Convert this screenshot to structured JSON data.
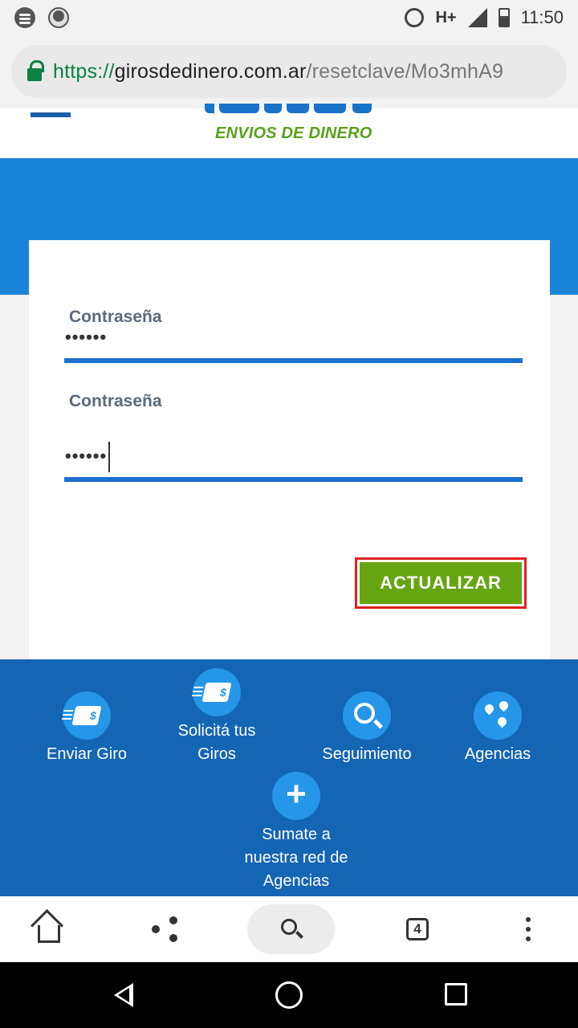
{
  "status_bar": {
    "network": "H+",
    "time": "11:50"
  },
  "url_bar": {
    "scheme": "https://",
    "host": "girosdedinero.com.ar",
    "path": "/resetclave/Mo3mhA9"
  },
  "header": {
    "logo_text": "ENVIOS DE DINERO"
  },
  "form": {
    "fields": [
      {
        "label": "Contraseña",
        "value": "••••••"
      },
      {
        "label": "Contraseña",
        "value": "••••••"
      }
    ],
    "submit_label": "ACTUALIZAR"
  },
  "footer": {
    "items": [
      {
        "label": "Enviar Giro"
      },
      {
        "label": "Solicitá tus Giros"
      },
      {
        "label": "Seguimiento"
      },
      {
        "label": "Agencias"
      },
      {
        "label": "Sumate a nuestra red de Agencias"
      }
    ]
  },
  "toolbar": {
    "tab_count": "4"
  },
  "colors": {
    "brand_blue": "#1a84d8",
    "footer_blue": "#1565b5",
    "accent_green": "#65a512",
    "highlight_red": "#e02020"
  }
}
